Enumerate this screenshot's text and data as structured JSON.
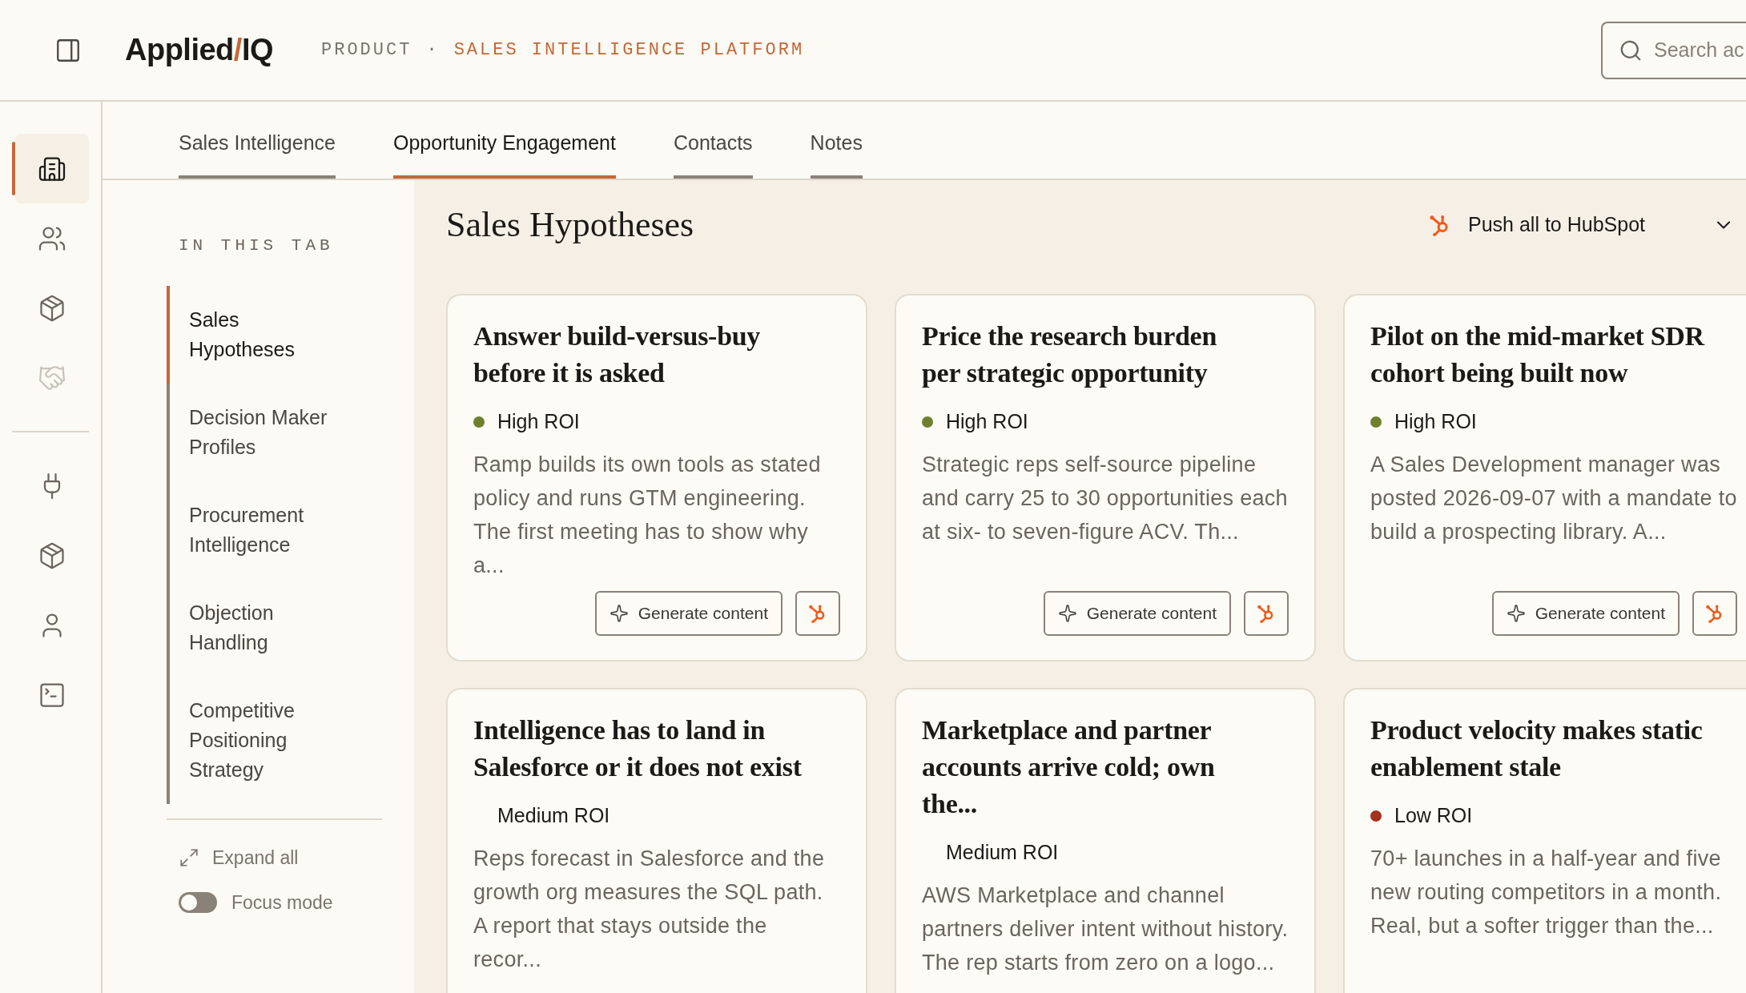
{
  "header": {
    "logo": [
      {
        "text": "Applied",
        "accent": false
      },
      {
        "text": "/",
        "accent": true
      },
      {
        "text": "IQ",
        "accent": false
      }
    ],
    "breadcrumb": [
      {
        "text": "PRODUCT",
        "accent": false
      },
      {
        "text": "·",
        "accent": false
      },
      {
        "text": "SALES INTELLIGENCE PLATFORM",
        "accent": true
      }
    ],
    "search": {
      "placeholder": "Search ac"
    }
  },
  "rail": [
    {
      "kind": "button",
      "selected": true,
      "disabled": false
    },
    {
      "kind": "button",
      "selected": false,
      "disabled": false
    },
    {
      "kind": "button",
      "selected": false,
      "disabled": false
    },
    {
      "kind": "button",
      "selected": false,
      "disabled": true
    },
    {
      "kind": "divider"
    },
    {
      "kind": "button",
      "selected": false,
      "disabled": false
    },
    {
      "kind": "button",
      "selected": false,
      "disabled": false
    },
    {
      "kind": "button",
      "selected": false,
      "disabled": false
    },
    {
      "kind": "button",
      "selected": false,
      "disabled": false
    }
  ],
  "tabs": [
    {
      "label": "Sales Intelligence",
      "selected": false
    },
    {
      "label": "Opportunity Engagement",
      "selected": true
    },
    {
      "label": "Contacts",
      "selected": false
    },
    {
      "label": "Notes",
      "selected": false
    }
  ],
  "outline": {
    "heading": "IN THIS TAB",
    "items": [
      {
        "label": "Sales Hypotheses",
        "selected": true
      },
      {
        "label": "Decision Maker Profiles",
        "selected": false
      },
      {
        "label": "Procurement Intelligence",
        "selected": false
      },
      {
        "label": "Objection Handling",
        "selected": false
      },
      {
        "label": "Competitive Positioning Strategy",
        "selected": false
      }
    ],
    "expand_all": "Expand all",
    "focus_mode": {
      "label": "Focus mode",
      "on": false
    }
  },
  "section": {
    "title": "Sales Hypotheses",
    "push_button": "Push all to HubSpot"
  },
  "cards": [
    {
      "title": "Answer build-versus-buy before it is asked",
      "roi": "High ROI",
      "color": "#6e7f2e",
      "body": "Ramp builds its own tools as stated policy and runs GTM engineering. The first meeting has to show why a...",
      "generate": "Generate content"
    },
    {
      "title": "Price the research burden per strategic opportunity",
      "roi": "High ROI",
      "color": "#6e7f2e",
      "body": "Strategic reps self-source pipeline and carry 25 to 30 opportunities each at six- to seven-figure ACV. Th...",
      "generate": "Generate content"
    },
    {
      "title": "Pilot on the mid-market SDR cohort being built now",
      "roi": "High ROI",
      "color": "#6e7f2e",
      "body": "A Sales Development manager was posted 2026-09-07 with a mandate to build a prospecting library. A...",
      "generate": "Generate content"
    },
    {
      "title": "Intelligence has to land in Salesforce or it does not exist",
      "roi": "Medium ROI",
      "body": "Reps forecast in Salesforce and the growth org measures the SQL path. A report that stays outside the recor..."
    },
    {
      "title": "Marketplace and partner accounts arrive cold; own the...",
      "roi": "Medium ROI",
      "body": "AWS Marketplace and channel partners deliver intent without history. The rep starts from zero on a logo..."
    },
    {
      "title": "Product velocity makes static enablement stale",
      "roi": "Low ROI",
      "color": "#a3321f",
      "body": "70+ launches in a half-year and five new routing competitors in a month. Real, but a softer trigger than the..."
    }
  ]
}
